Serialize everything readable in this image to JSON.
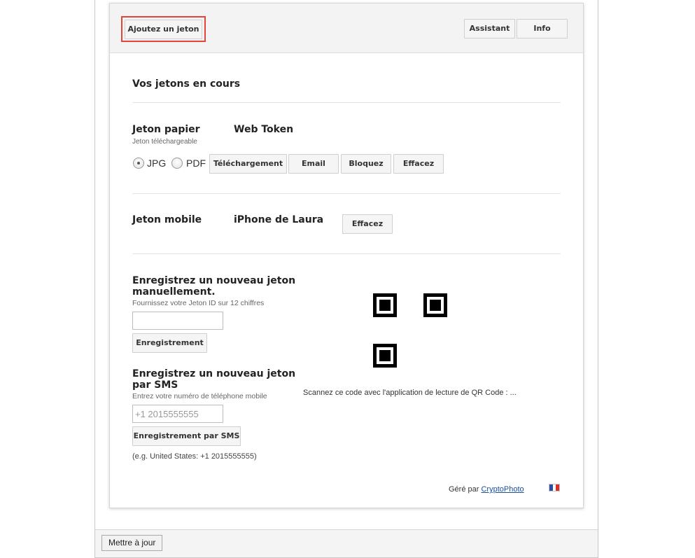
{
  "header": {
    "add_token": "Ajoutez un jeton",
    "assistant": "Assistant",
    "info": "Info"
  },
  "current_tokens_title": "Vos jetons en cours",
  "paper_token": {
    "label": "Jeton papier",
    "sublabel": "Jeton téléchargeable",
    "name": "Web Token",
    "format_options": [
      "JPG",
      "PDF"
    ],
    "selected_format": "JPG",
    "buttons": {
      "download": "Téléchargement",
      "email": "Email",
      "block": "Bloquez",
      "delete": "Effacez"
    }
  },
  "mobile_token": {
    "label": "Jeton mobile",
    "name": "iPhone de Laura",
    "delete": "Effacez"
  },
  "manual_registration": {
    "title": "Enregistrez un nouveau jeton manuellement.",
    "hint": "Fournissez votre Jeton ID sur 12 chiffres",
    "value": "",
    "button": "Enregistrement"
  },
  "sms_registration": {
    "title": "Enregistrez un nouveau jeton par SMS",
    "hint": "Entrez votre numéro de téléphone mobile",
    "placeholder": "+1 2015555555",
    "button": "Enregistrement par SMS",
    "example": "(e.g. United States: +1 2015555555)"
  },
  "qr": {
    "caption": "Scannez ce code avec l'application de lecture de QR Code : ..."
  },
  "footer": {
    "managed_by": "Géré par",
    "provider": "CryptoPhoto",
    "language_flag": "flag-fr-icon",
    "flag_colors": [
      "#2d4ea3",
      "#ffffff",
      "#d9312c"
    ]
  },
  "bottom_bar": {
    "update_button": "Mettre à jour"
  },
  "colors": {
    "highlight_outline": "#e0463a",
    "link": "#1a4f9c"
  }
}
